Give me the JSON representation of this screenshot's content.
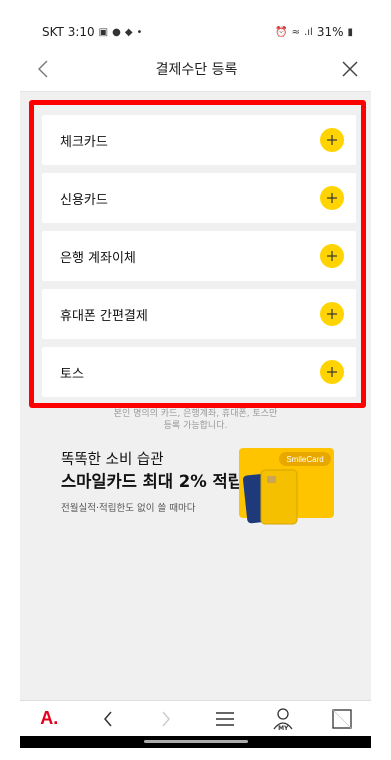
{
  "status_bar": {
    "carrier_time": "SKT 3:10",
    "battery": "31%",
    "signal_text": ".ıl"
  },
  "header": {
    "title": "결제수단 등록"
  },
  "payment_methods": [
    {
      "label": "체크카드"
    },
    {
      "label": "신용카드"
    },
    {
      "label": "은행 계좌이체"
    },
    {
      "label": "휴대폰 간편결제"
    },
    {
      "label": "토스"
    }
  ],
  "note": {
    "line1": "본인 명의의 카드, 은행계좌, 휴대폰, 토스만",
    "line2": "등록 가능합니다."
  },
  "banner": {
    "line1": "똑똑한 소비 습관",
    "line2": "스마일카드 최대 2% 적립",
    "line3": "전월실적·적립한도 없이 쓸 때마다",
    "card_brand": "SmileCard"
  },
  "bottom_nav": {
    "logo": "A.",
    "my_label": "MY"
  },
  "colors": {
    "accent_yellow": "#ffd400",
    "highlight_red": "#ff0000",
    "logo_red": "#e3001b"
  }
}
